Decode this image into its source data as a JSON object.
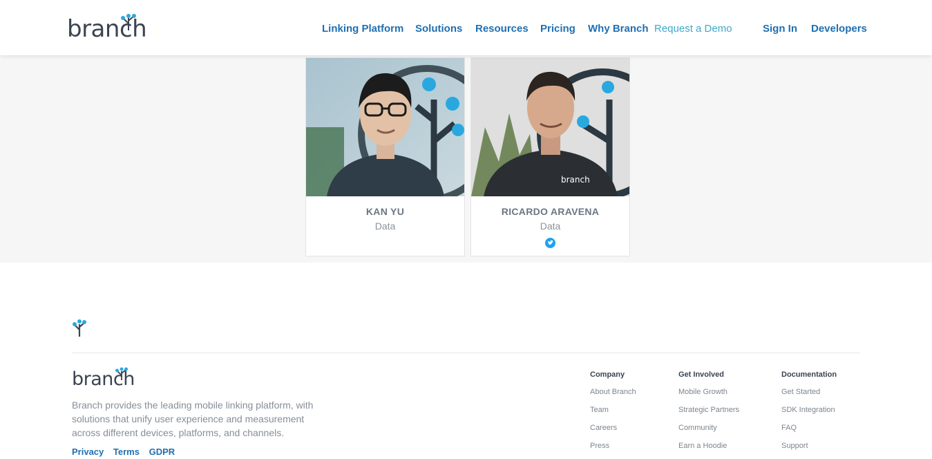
{
  "header": {
    "logo_text": "branch",
    "nav": [
      {
        "label": "Linking Platform"
      },
      {
        "label": "Solutions"
      },
      {
        "label": "Resources"
      },
      {
        "label": "Pricing"
      },
      {
        "label": "Why Branch"
      },
      {
        "label": "Request a Demo"
      },
      {
        "label": "Sign In"
      },
      {
        "label": "Developers"
      }
    ]
  },
  "team": [
    {
      "name": "KAN YU",
      "role": "Data"
    },
    {
      "name": "RICARDO ARAVENA",
      "role": "Data",
      "icon": "twitter-icon",
      "shirt_text": "branch"
    }
  ],
  "footer": {
    "logo_text": "branch",
    "description": "Branch provides the leading mobile linking platform, with solutions that unify user experience and measurement across different devices, platforms, and channels.",
    "legal": [
      "Privacy",
      "Terms",
      "GDPR"
    ],
    "columns": [
      {
        "heading": "Company",
        "items": [
          "About Branch",
          "Team",
          "Careers",
          "Press"
        ]
      },
      {
        "heading": "Get Involved",
        "items": [
          "Mobile Growth",
          "Strategic Partners",
          "Community",
          "Earn a Hoodie"
        ]
      },
      {
        "heading": "Documentation",
        "items": [
          "Get Started",
          "SDK Integration",
          "FAQ",
          "Support"
        ]
      }
    ]
  },
  "colors": {
    "brand_blue": "#1f6fb1",
    "accent_teal": "#3fa8c8",
    "tree_dot": "#29a8e0"
  }
}
